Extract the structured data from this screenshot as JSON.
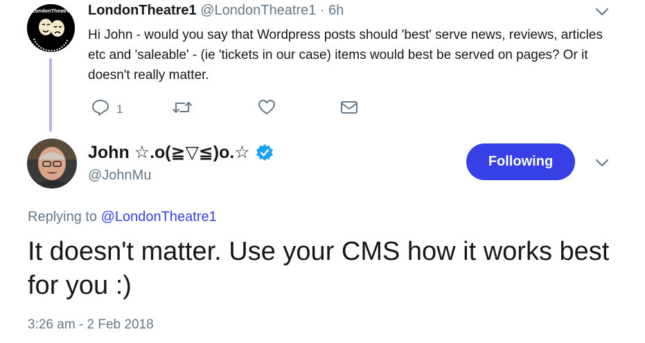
{
  "parent_tweet": {
    "avatar_logo_text": "LondonTheatre",
    "name": "LondonTheatre1",
    "handle": "@LondonTheatre1",
    "separator": "·",
    "time": "6h",
    "text": "Hi John - would you say that Wordpress posts should 'best' serve news, reviews, articles etc and 'saleable' - (ie 'tickets in our case) items would best be served on pages? Or it doesn't really matter.",
    "actions": {
      "reply_icon": "reply-icon",
      "reply_count": "1",
      "retweet_icon": "retweet-icon",
      "like_icon": "heart-icon",
      "dm_icon": "envelope-icon"
    }
  },
  "main_tweet": {
    "name": "John ☆.o(≧▽≦)o.☆",
    "handle": "@JohnMu",
    "verified_icon": "verified-badge-icon",
    "follow_button_label": "Following",
    "replying_prefix": "Replying to",
    "replying_to": "@LondonTheatre1",
    "text": "It doesn't matter. Use your CMS how it works best for you :)",
    "timestamp": "3:26 am - 2 Feb 2018"
  },
  "colors": {
    "accent": "#3740e6",
    "muted": "#657786",
    "text": "#14171a",
    "thread_line": "#b8b2ee"
  }
}
